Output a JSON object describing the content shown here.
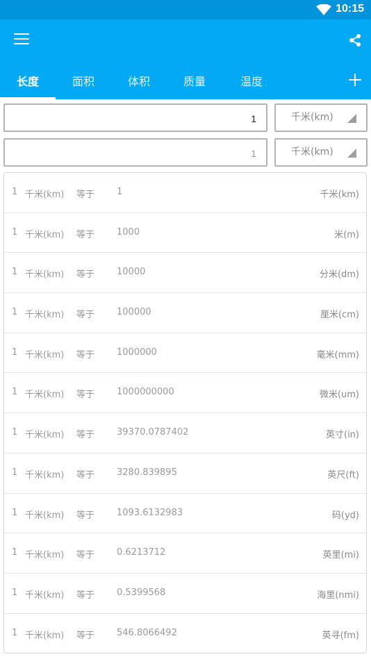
{
  "status": {
    "time": "10:15"
  },
  "tabs": [
    {
      "label": "长度",
      "active": true
    },
    {
      "label": "面积",
      "active": false
    },
    {
      "label": "体积",
      "active": false
    },
    {
      "label": "质量",
      "active": false
    },
    {
      "label": "温度",
      "active": false
    }
  ],
  "colors": {
    "accent": "#03a9f4",
    "statusbar": "#0293dd"
  },
  "input1": {
    "value": "1",
    "unit": "千米(km)"
  },
  "input2": {
    "value": "1",
    "unit": "千米(km)"
  },
  "results": [
    {
      "num": "1",
      "from": "千米(km)",
      "eq": "等于",
      "value": "1",
      "to": "千米(km)"
    },
    {
      "num": "1",
      "from": "千米(km)",
      "eq": "等于",
      "value": "1000",
      "to": "米(m)"
    },
    {
      "num": "1",
      "from": "千米(km)",
      "eq": "等于",
      "value": "10000",
      "to": "分米(dm)"
    },
    {
      "num": "1",
      "from": "千米(km)",
      "eq": "等于",
      "value": "100000",
      "to": "厘米(cm)"
    },
    {
      "num": "1",
      "from": "千米(km)",
      "eq": "等于",
      "value": "1000000",
      "to": "毫米(mm)"
    },
    {
      "num": "1",
      "from": "千米(km)",
      "eq": "等于",
      "value": "1000000000",
      "to": "微米(um)"
    },
    {
      "num": "1",
      "from": "千米(km)",
      "eq": "等于",
      "value": "39370.0787402",
      "to": "英寸(in)"
    },
    {
      "num": "1",
      "from": "千米(km)",
      "eq": "等于",
      "value": "3280.839895",
      "to": "英尺(ft)"
    },
    {
      "num": "1",
      "from": "千米(km)",
      "eq": "等于",
      "value": "1093.6132983",
      "to": "码(yd)"
    },
    {
      "num": "1",
      "from": "千米(km)",
      "eq": "等于",
      "value": "0.6213712",
      "to": "英里(mi)"
    },
    {
      "num": "1",
      "from": "千米(km)",
      "eq": "等于",
      "value": "0.5399568",
      "to": "海里(nmi)"
    },
    {
      "num": "1",
      "from": "千米(km)",
      "eq": "等于",
      "value": "546.8066492",
      "to": "英寻(fm)"
    }
  ]
}
